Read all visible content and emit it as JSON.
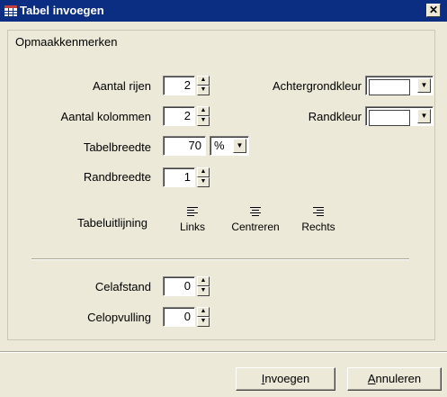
{
  "window": {
    "title": "Tabel invoegen",
    "close_glyph": "✕"
  },
  "group": {
    "legend": "Opmaakkenmerken"
  },
  "rows": {
    "label": "Aantal rijen",
    "value": "2"
  },
  "columns": {
    "label": "Aantal kolommen",
    "value": "2"
  },
  "width": {
    "label": "Tabelbreedte",
    "value": "70",
    "unit": "%"
  },
  "border": {
    "label": "Randbreedte",
    "value": "1"
  },
  "background_color": {
    "label": "Achtergrondkleur",
    "color": "#ffffff"
  },
  "border_color": {
    "label": "Randkleur",
    "color": "#ffffff"
  },
  "alignment": {
    "label": "Tabeluitlijning",
    "options": [
      {
        "label": "Links",
        "icon": "align-left-icon"
      },
      {
        "label": "Centreren",
        "icon": "align-center-icon"
      },
      {
        "label": "Rechts",
        "icon": "align-right-icon"
      }
    ]
  },
  "cellspacing": {
    "label": "Celafstand",
    "value": "0"
  },
  "cellpadding": {
    "label": "Celopvulling",
    "value": "0"
  },
  "buttons": {
    "insert_accel": "I",
    "insert_rest": "nvoegen",
    "cancel_accel": "A",
    "cancel_rest": "nnuleren"
  },
  "colors": {
    "titlebar": "#0b2e83",
    "dialog_bg": "#ece9d8"
  }
}
